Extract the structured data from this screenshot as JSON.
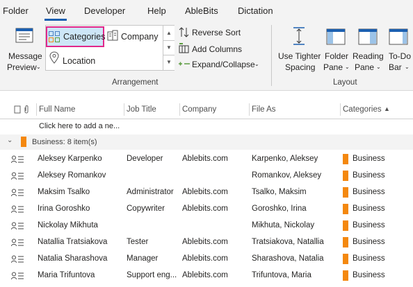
{
  "menu": {
    "tabs": [
      "Folder",
      "View",
      "Developer",
      "Help",
      "AbleBits",
      "Dictation"
    ],
    "active": "View"
  },
  "ribbon": {
    "message_preview": [
      "Message",
      "Preview"
    ],
    "gallery": {
      "categories": "Categories",
      "company": "Company",
      "location": "Location"
    },
    "arrangement_cmds": {
      "reverse_sort": "Reverse Sort",
      "add_columns": "Add Columns",
      "expand_collapse": "Expand/Collapse"
    },
    "layout_cmds": {
      "tighter_spacing": [
        "Use Tighter",
        "Spacing"
      ],
      "folder_pane": [
        "Folder",
        "Pane"
      ],
      "reading_pane": [
        "Reading",
        "Pane"
      ],
      "todo_bar": [
        "To-Do",
        "Bar"
      ]
    },
    "groups": {
      "arrangement": "Arrangement",
      "layout": "Layout"
    }
  },
  "list": {
    "headers": {
      "full_name": "Full Name",
      "job_title": "Job Title",
      "company": "Company",
      "file_as": "File As",
      "categories": "Categories"
    },
    "add_new": "Click here to add a ne...",
    "group_label": "Business: 8 item(s)",
    "rows": [
      {
        "name": "Aleksey Karpenko",
        "title": "Developer",
        "company": "Ablebits.com",
        "file_as": "Karpenko, Aleksey",
        "category": "Business"
      },
      {
        "name": "Aleksey Romankov",
        "title": "",
        "company": "",
        "file_as": "Romankov, Aleksey",
        "category": "Business"
      },
      {
        "name": "Maksim Tsalko",
        "title": "Administrator",
        "company": "Ablebits.com",
        "file_as": "Tsalko, Maksim",
        "category": "Business"
      },
      {
        "name": "Irina Goroshko",
        "title": "Copywriter",
        "company": "Ablebits.com",
        "file_as": "Goroshko, Irina",
        "category": "Business"
      },
      {
        "name": "Nickolay Mikhuta",
        "title": "",
        "company": "",
        "file_as": "Mikhuta, Nickolay",
        "category": "Business"
      },
      {
        "name": "Natallia Tratsiakova",
        "title": "Tester",
        "company": "Ablebits.com",
        "file_as": "Tratsiakova, Natallia",
        "category": "Business"
      },
      {
        "name": "Natalia Sharashova",
        "title": "Manager",
        "company": "Ablebits.com",
        "file_as": "Sharashova, Natalia",
        "category": "Business"
      },
      {
        "name": "Maria Trifuntova",
        "title": "Support eng...",
        "company": "Ablebits.com",
        "file_as": "Trifuntova, Maria",
        "category": "Business"
      }
    ]
  },
  "colors": {
    "category_business": "#f4880f",
    "accent": "#1b5fb0",
    "selection_outline": "#e0288a"
  }
}
